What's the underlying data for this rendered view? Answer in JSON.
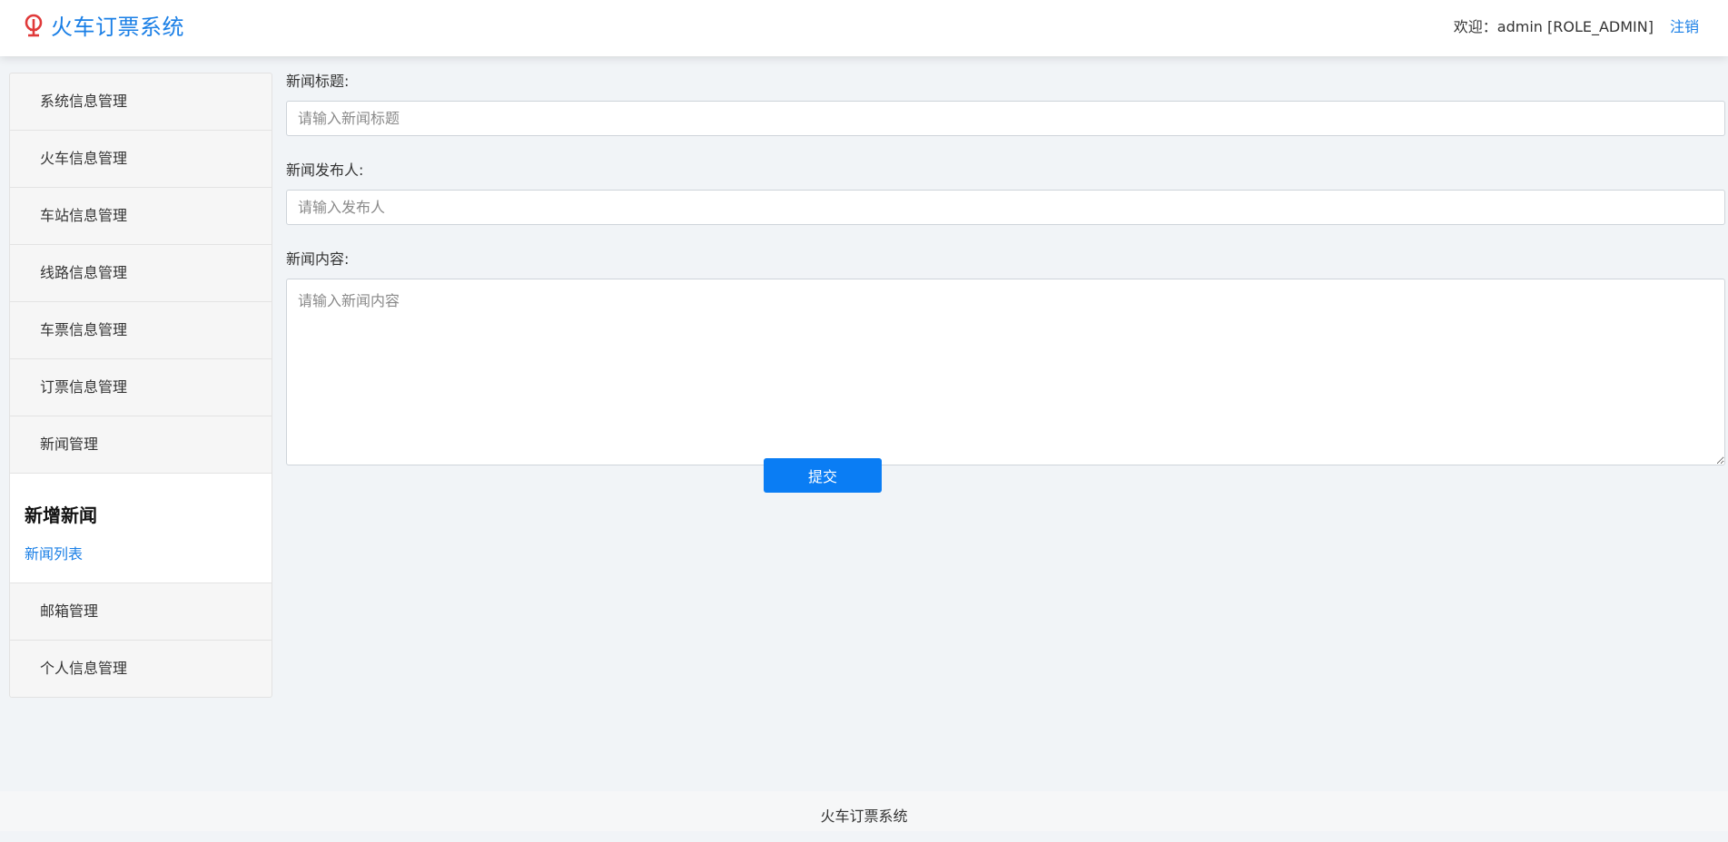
{
  "header": {
    "brand_title": "火车订票系统",
    "brand_icon": "railway-logo-icon",
    "welcome_text": "欢迎：admin [ROLE_ADMIN]",
    "logout_label": "注销",
    "accent_color": "#1a7fe6",
    "logo_color": "#e03a3a"
  },
  "sidebar": {
    "items_top": [
      {
        "label": "系统信息管理"
      },
      {
        "label": "火车信息管理"
      },
      {
        "label": "车站信息管理"
      },
      {
        "label": "线路信息管理"
      },
      {
        "label": "车票信息管理"
      },
      {
        "label": "订票信息管理"
      },
      {
        "label": "新闻管理"
      }
    ],
    "active_section": {
      "title": "新增新闻",
      "link": "新闻列表"
    },
    "items_bottom": [
      {
        "label": "邮箱管理"
      },
      {
        "label": "个人信息管理"
      }
    ]
  },
  "form": {
    "title_label": "新闻标题:",
    "title_placeholder": "请输入新闻标题",
    "title_value": "",
    "publisher_label": "新闻发布人:",
    "publisher_placeholder": "请输入发布人",
    "publisher_value": "",
    "content_label": "新闻内容:",
    "content_placeholder": "请输入新闻内容",
    "content_value": "",
    "submit_label": "提交",
    "submit_color": "#0a7df4"
  },
  "footer": {
    "text": "火车订票系统"
  }
}
